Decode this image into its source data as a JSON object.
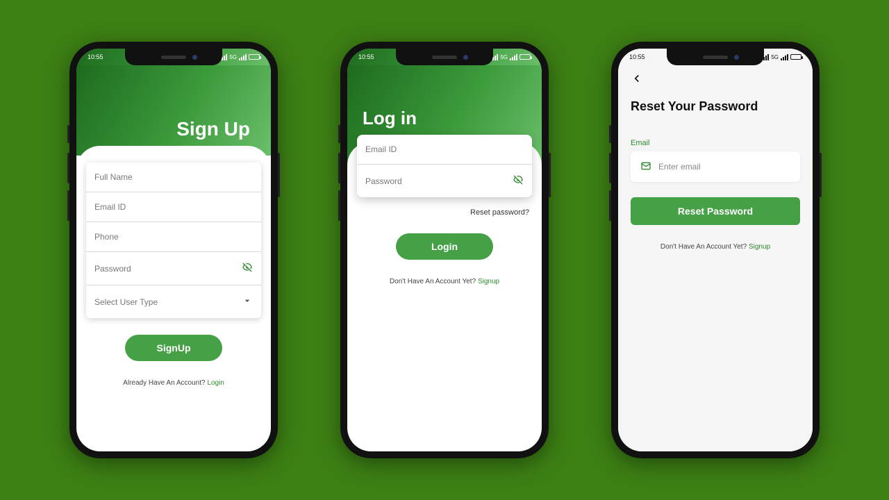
{
  "status": {
    "time": "10:55"
  },
  "signup": {
    "title": "Sign Up",
    "fields": {
      "fullname": "Full Name",
      "email": "Email ID",
      "phone": "Phone",
      "password": "Password",
      "usertype": "Select User Type"
    },
    "button": "SignUp",
    "footer_text": "Already Have An Account? ",
    "footer_link": "Login"
  },
  "login": {
    "title": "Log in",
    "fields": {
      "email": "Email ID",
      "password": "Password"
    },
    "reset_link": "Reset password?",
    "button": "Login",
    "footer_text": "Don't Have An Account Yet? ",
    "footer_link": "Signup"
  },
  "reset": {
    "title": "Reset Your Password",
    "email_label": "Email",
    "email_placeholder": "Enter email",
    "button": "Reset Password",
    "footer_text": "Don't Have An Account Yet? ",
    "footer_link": "Signup"
  }
}
